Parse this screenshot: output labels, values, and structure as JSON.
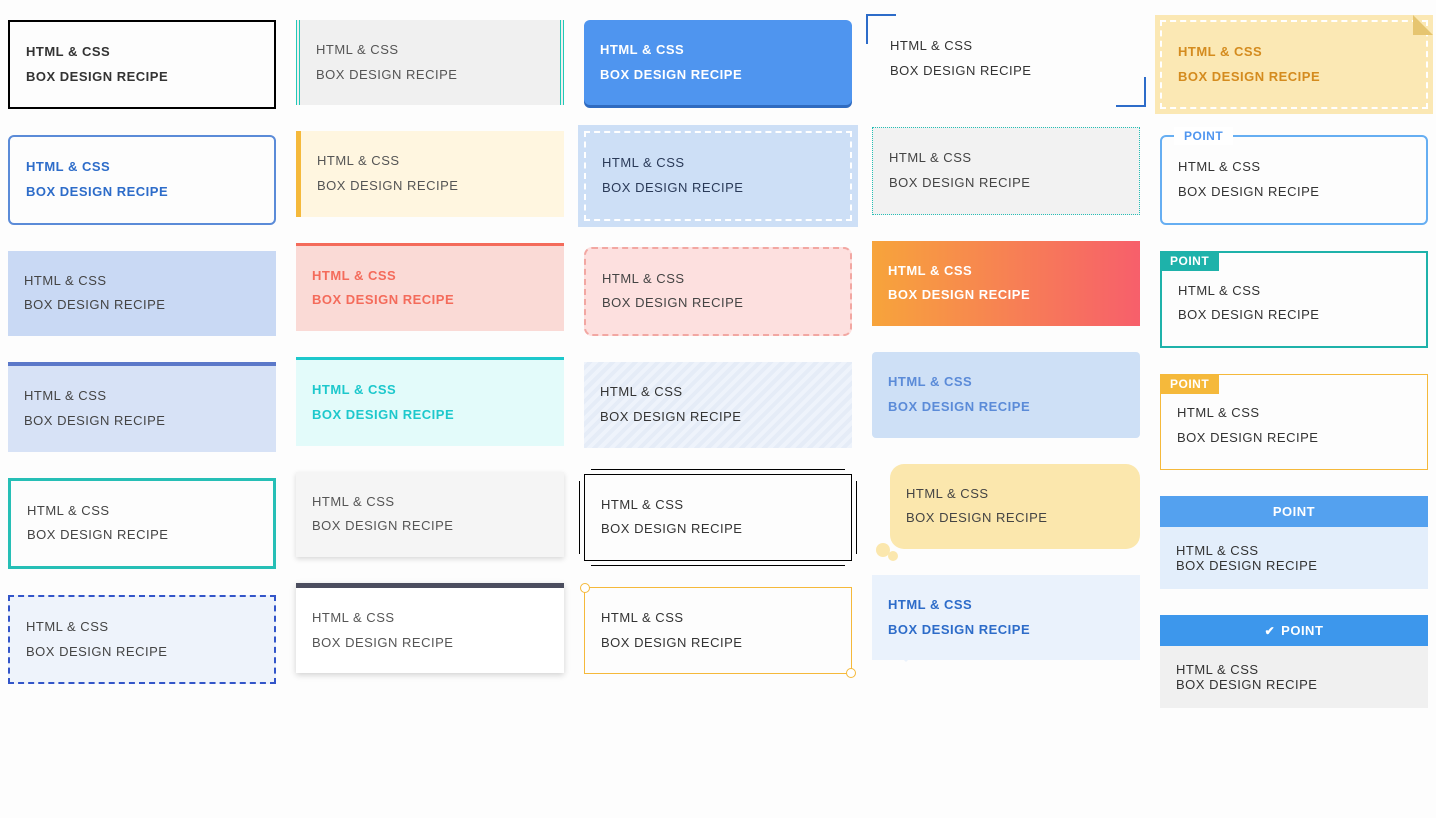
{
  "text": {
    "line1": "HTML & CSS",
    "line2": "BOX DESIGN RECIPE"
  },
  "point_label": "POINT"
}
